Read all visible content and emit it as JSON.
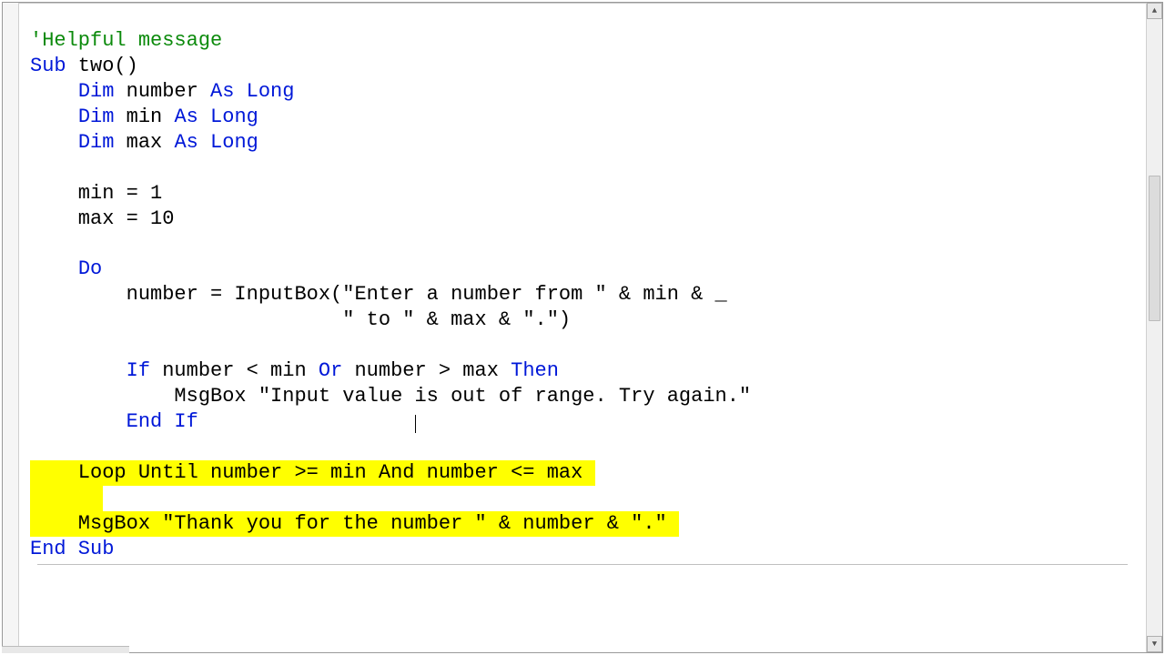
{
  "code": {
    "comment": "'Helpful message",
    "sub_kw": "Sub",
    "sub_name": " two()",
    "dim_kw": "Dim",
    "as_kw": "As",
    "long_kw": "Long",
    "var_number": " number ",
    "var_min": " min ",
    "var_max": " max ",
    "assign_min": "    min = 1",
    "assign_max": "    max = 10",
    "do_kw": "Do",
    "inputbox_line1a": "        number = InputBox(",
    "inputbox_str1": "\"Enter a number from \"",
    "inputbox_line1b": " & min & _",
    "inputbox_line2a": "                          ",
    "inputbox_str2": "\" to \"",
    "inputbox_line2b": " & max & ",
    "inputbox_str3": "\".\"",
    "inputbox_line2c": ")",
    "if_kw": "If",
    "if_cond1": " number < min ",
    "or_kw": "Or",
    "if_cond2": " number > max ",
    "then_kw": "Then",
    "msgbox1a": "            MsgBox ",
    "msgbox1_str": "\"Input value is out of range. Try again.\"",
    "endif_kw": "End If",
    "loop_line_a": "    Loop Until number >= min And number <= max ",
    "msgbox2_a": "    MsgBox ",
    "msgbox2_str": "\"Thank you for the number \"",
    "msgbox2_b": " & number & ",
    "msgbox2_str2": "\".\"",
    "endsub_kw": "End Sub"
  },
  "scroll": {
    "up": "▲",
    "down": "▼"
  }
}
